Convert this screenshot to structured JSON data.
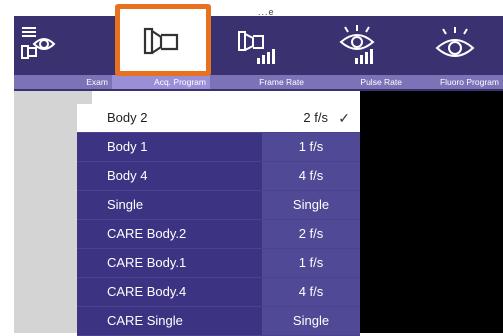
{
  "top_fragment": "...e",
  "toolbar": {
    "tabs": [
      {
        "label": "Exam",
        "icon": "exam-eye-icon"
      },
      {
        "label": "Acq. Program",
        "icon": "acquisition-camera-icon"
      },
      {
        "label": "Frame Rate",
        "icon": "frame-rate-icon"
      },
      {
        "label": "Pulse Rate",
        "icon": "pulse-rate-eye-icon"
      },
      {
        "label": "Fluoro Program",
        "icon": "fluoro-eye-icon"
      }
    ],
    "selected_tab": "Acq. Program"
  },
  "menu": {
    "items": [
      {
        "name": "Body 2",
        "rate": "2 f/s",
        "selected": true
      },
      {
        "name": "Body 1",
        "rate": "1 f/s"
      },
      {
        "name": "Body 4",
        "rate": "4 f/s"
      },
      {
        "name": "Single",
        "rate": "Single"
      },
      {
        "name": "CARE Body.2",
        "rate": "2 f/s"
      },
      {
        "name": "CARE Body.1",
        "rate": "1 f/s"
      },
      {
        "name": "CARE Body.4",
        "rate": "4 f/s"
      },
      {
        "name": "CARE Single",
        "rate": "Single"
      }
    ],
    "check_glyph": "✓"
  },
  "colors": {
    "toolbar_bg": "#3a3170",
    "label_bg": "#7b72b8",
    "highlight": "#e8711f",
    "menu_bg": "#3c3483"
  }
}
